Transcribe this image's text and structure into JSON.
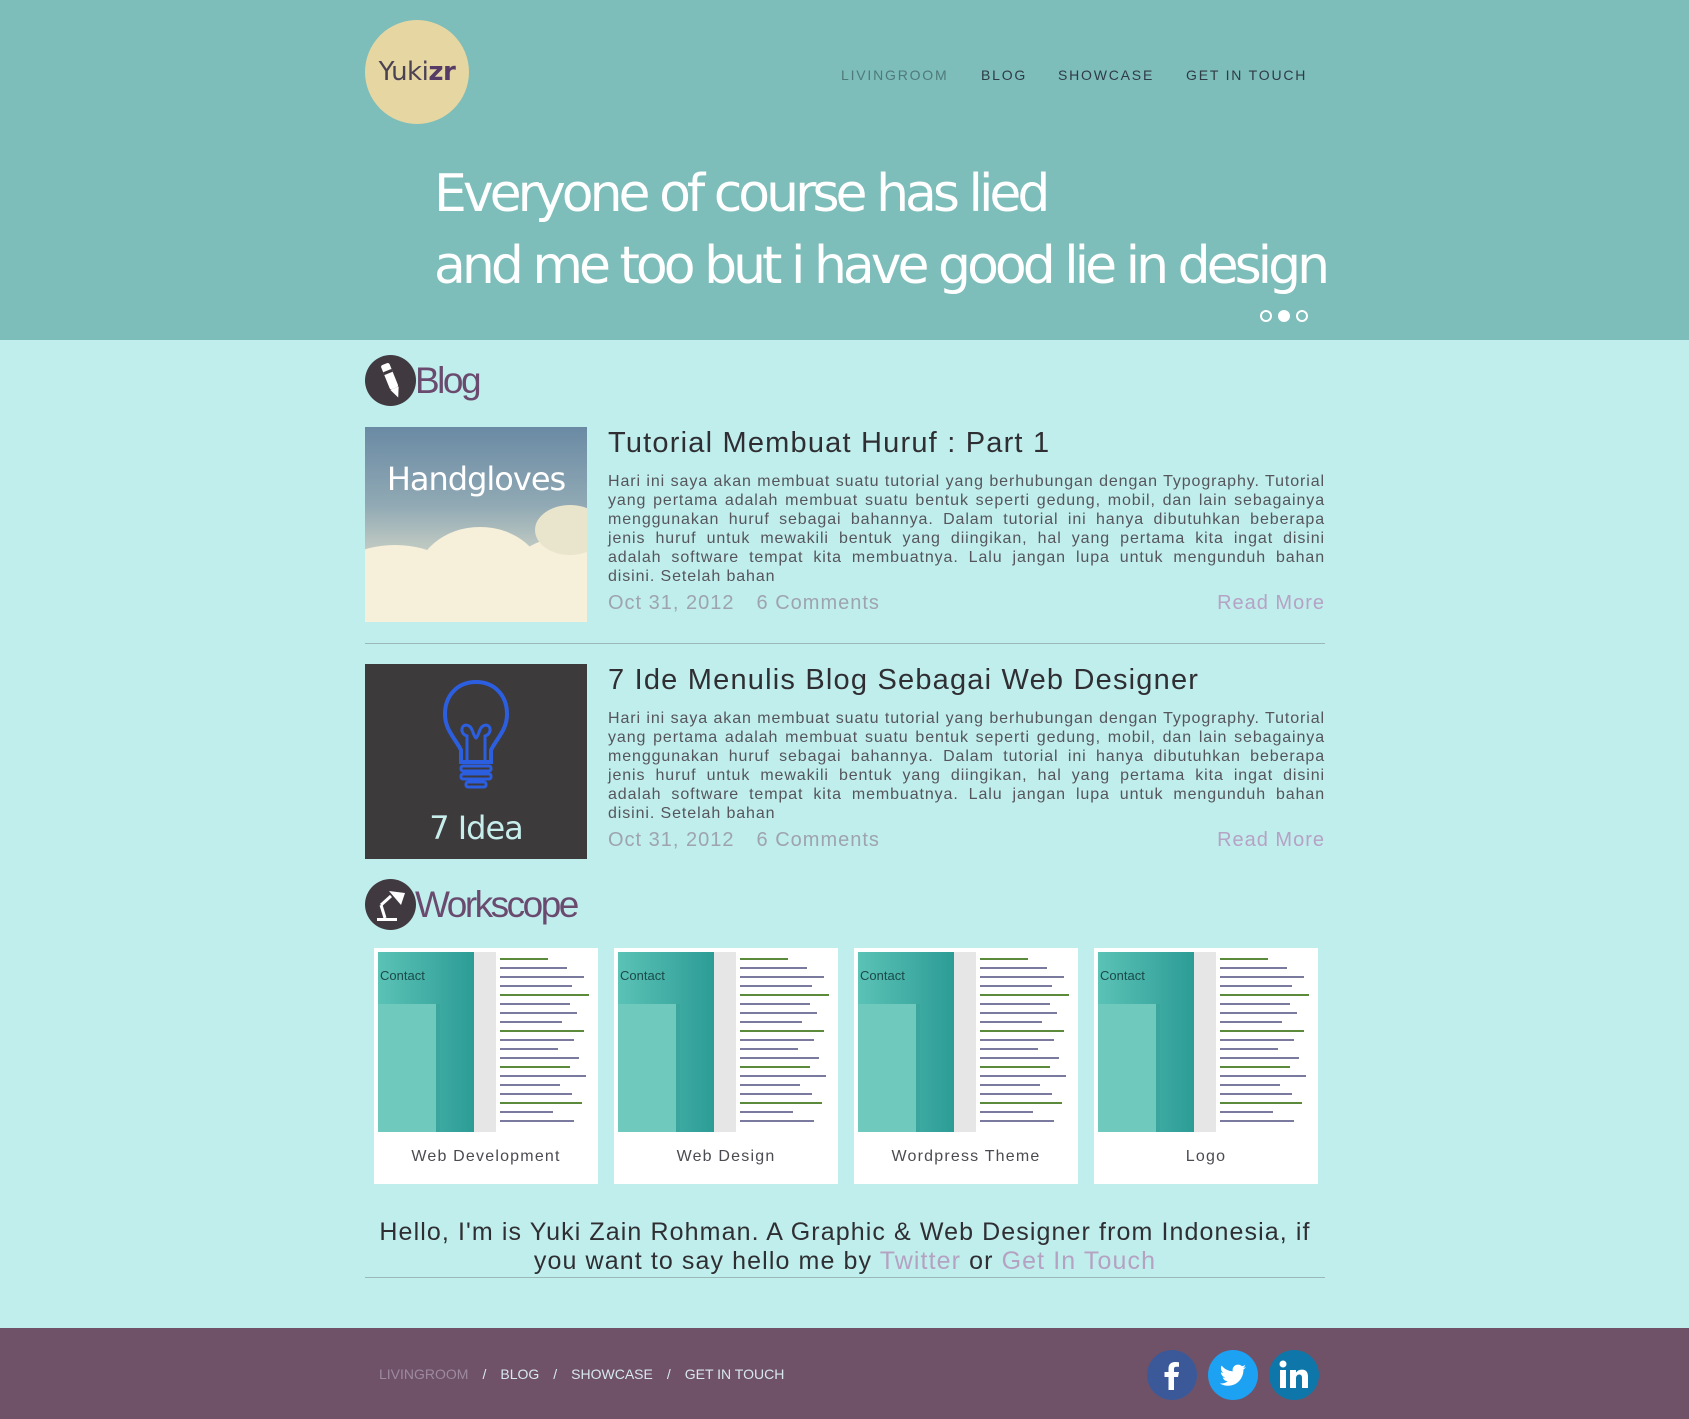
{
  "header": {
    "logo": {
      "regular": "Yuki",
      "bold": "zr"
    },
    "nav": [
      {
        "label": "LIVINGROOM",
        "active": true
      },
      {
        "label": "BLOG"
      },
      {
        "label": "SHOWCASE"
      },
      {
        "label": "GET IN TOUCH"
      }
    ],
    "tagline": [
      "Everyone of course has lied",
      "and me too but i have good lie in design"
    ],
    "slider": {
      "slides": 3,
      "active": 2
    }
  },
  "blog": {
    "title": "Blog",
    "posts": [
      {
        "thumb_text": "Handgloves",
        "title": "Tutorial Membuat Huruf : Part 1",
        "excerpt": "Hari ini saya akan membuat suatu tutorial yang berhubungan dengan Typography. Tutorial yang pertama adalah membuat suatu bentuk seperti gedung, mobil, dan lain sebagainya menggunakan huruf sebagai bahannya. Dalam tutorial ini hanya dibutuhkan beberapa jenis huruf untuk mewakili bentuk yang diingikan, hal yang pertama kita ingat disini adalah software tempat kita membuatnya. Lalu jangan lupa untuk mengunduh bahan disini. Setelah bahan",
        "date": "Oct 31, 2012",
        "comments": "6 Comments",
        "read_more": "Read More"
      },
      {
        "thumb_text": "7 Idea",
        "title": "7 Ide Menulis Blog Sebagai Web Designer",
        "excerpt": "Hari ini saya akan membuat suatu tutorial yang berhubungan dengan Typography. Tutorial yang pertama adalah membuat suatu bentuk seperti gedung, mobil, dan lain sebagainya menggunakan huruf sebagai bahannya. Dalam tutorial ini hanya dibutuhkan beberapa jenis huruf untuk mewakili bentuk yang diingikan, hal yang pertama kita ingat disini adalah software tempat kita membuatnya. Lalu jangan lupa untuk mengunduh bahan disini. Setelah bahan",
        "date": "Oct 31, 2012",
        "comments": "6 Comments",
        "read_more": "Read More"
      }
    ]
  },
  "workscope": {
    "title": "Workscope",
    "shot_text": "Contact",
    "items": [
      {
        "label": "Web Development"
      },
      {
        "label": "Web Design"
      },
      {
        "label": "Wordpress Theme"
      },
      {
        "label": "Logo"
      }
    ]
  },
  "intro": {
    "text_before": "Hello, I'm is Yuki Zain Rohman. A Graphic & Web Designer from Indonesia, if you want to say hello me by",
    "link_twitter": "Twitter",
    "text_mid": "or",
    "link_touch": "Get In Touch"
  },
  "footer": {
    "nav": [
      {
        "label": "LIVINGROOM",
        "active": true
      },
      {
        "label": "BLOG"
      },
      {
        "label": "SHOWCASE"
      },
      {
        "label": "GET IN TOUCH"
      }
    ],
    "separator": "/",
    "social": [
      {
        "icon": "facebook-icon",
        "glyph": "f",
        "color": "#3b5998"
      },
      {
        "icon": "twitter-icon",
        "glyph": "t",
        "color": "#1da1f2"
      },
      {
        "icon": "linkedin-icon",
        "glyph": "in",
        "color": "#0e76a8"
      }
    ]
  },
  "colors": {
    "hero_bg": "#7dbdba",
    "page_bg": "#c0eeec",
    "footer_bg": "#6f5268",
    "accent": "#b5a2c2"
  }
}
